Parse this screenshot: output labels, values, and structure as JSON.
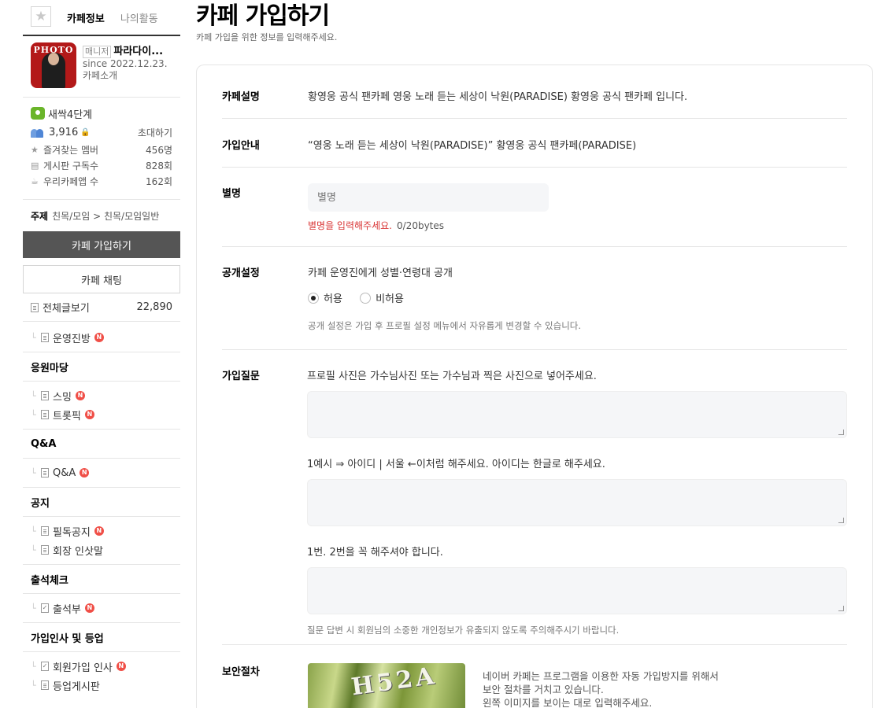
{
  "sidebar": {
    "tabs": [
      "카페정보",
      "나의활동"
    ],
    "profile": {
      "thumb_text": "PHOTO",
      "manager_badge": "매니저",
      "name": "파라다이...",
      "since": "since 2022.12.23.",
      "intro": "카페소개"
    },
    "stats": {
      "level": "새싹4단계",
      "members": "3,916",
      "invite": "초대하기",
      "rows": [
        {
          "label": "즐겨찾는 멤버",
          "value": "456명"
        },
        {
          "label": "게시판 구독수",
          "value": "828회"
        },
        {
          "label": "우리카페앱 수",
          "value": "162회"
        }
      ]
    },
    "topic": {
      "label": "주제",
      "value": "친목/모임 > 친목/모임일반"
    },
    "join_button": "카페 가입하기",
    "chat_button": "카페 채팅",
    "all_posts": {
      "label": "전체글보기",
      "count": "22,890"
    },
    "admin_room": "운영진방",
    "groups": [
      {
        "title": "응원마당",
        "items": [
          "스밍",
          "트롯픽"
        ]
      },
      {
        "title": "Q&A",
        "items": [
          "Q&A"
        ]
      },
      {
        "title": "공지",
        "items": [
          "필독공지",
          "회장 인삿말"
        ]
      },
      {
        "title": "출석체크",
        "items": [
          "출석부"
        ]
      },
      {
        "title": "가입인사 및 등업",
        "items": [
          "회원가입 인사",
          "등업게시판"
        ]
      }
    ],
    "new_badge": "N"
  },
  "main": {
    "title": "카페 가입하기",
    "subtitle": "카페 가입을 위한 정보를 입력해주세요.",
    "rows": {
      "desc": {
        "label": "카페설명",
        "text": "황영웅 공식 팬카페 영웅 노래 듣는 세상이 낙원(PARADISE) 황영웅 공식 팬카페 입니다."
      },
      "guide": {
        "label": "가입안내",
        "text": "“영웅 노래 듣는 세상이 낙원(PARADISE)” 황영웅 공식 팬카페(PARADISE)"
      },
      "nickname": {
        "label": "별명",
        "placeholder": "별명",
        "error": "별명을 입력해주세요.",
        "bytes": "0/20bytes"
      },
      "privacy": {
        "label": "공개설정",
        "text": "카페 운영진에게 성별·연령대 공개",
        "allow": "허용",
        "deny": "비허용",
        "hint": "공개 설정은 가입 후 프로필 설정 메뉴에서 자유롭게 변경할 수 있습니다."
      },
      "questions": {
        "label": "가입질문",
        "items": [
          "프로필 사진은 가수님사진 또는 가수님과 찍은 사진으로 넣어주세요.",
          "1예시 ⇒ 아이디 | 서울 ←이처럼 해주세요. 아이디는 한글로 해주세요.",
          "1번. 2번을 꼭 해주셔야 합니다."
        ],
        "hint": "질문 답변 시 회원님의 소중한 개인정보가 유출되지 않도록 주의해주시기 바랍니다."
      },
      "security": {
        "label": "보안절차",
        "captcha_text": "H52A",
        "desc_lines": [
          "네이버 카페는 프로그램을 이용한 자동 가입방지를 위해서",
          "보안 절차를 거치고 있습니다.",
          "왼쪽 이미지를 보이는 대로 입력해주세요."
        ]
      }
    }
  }
}
